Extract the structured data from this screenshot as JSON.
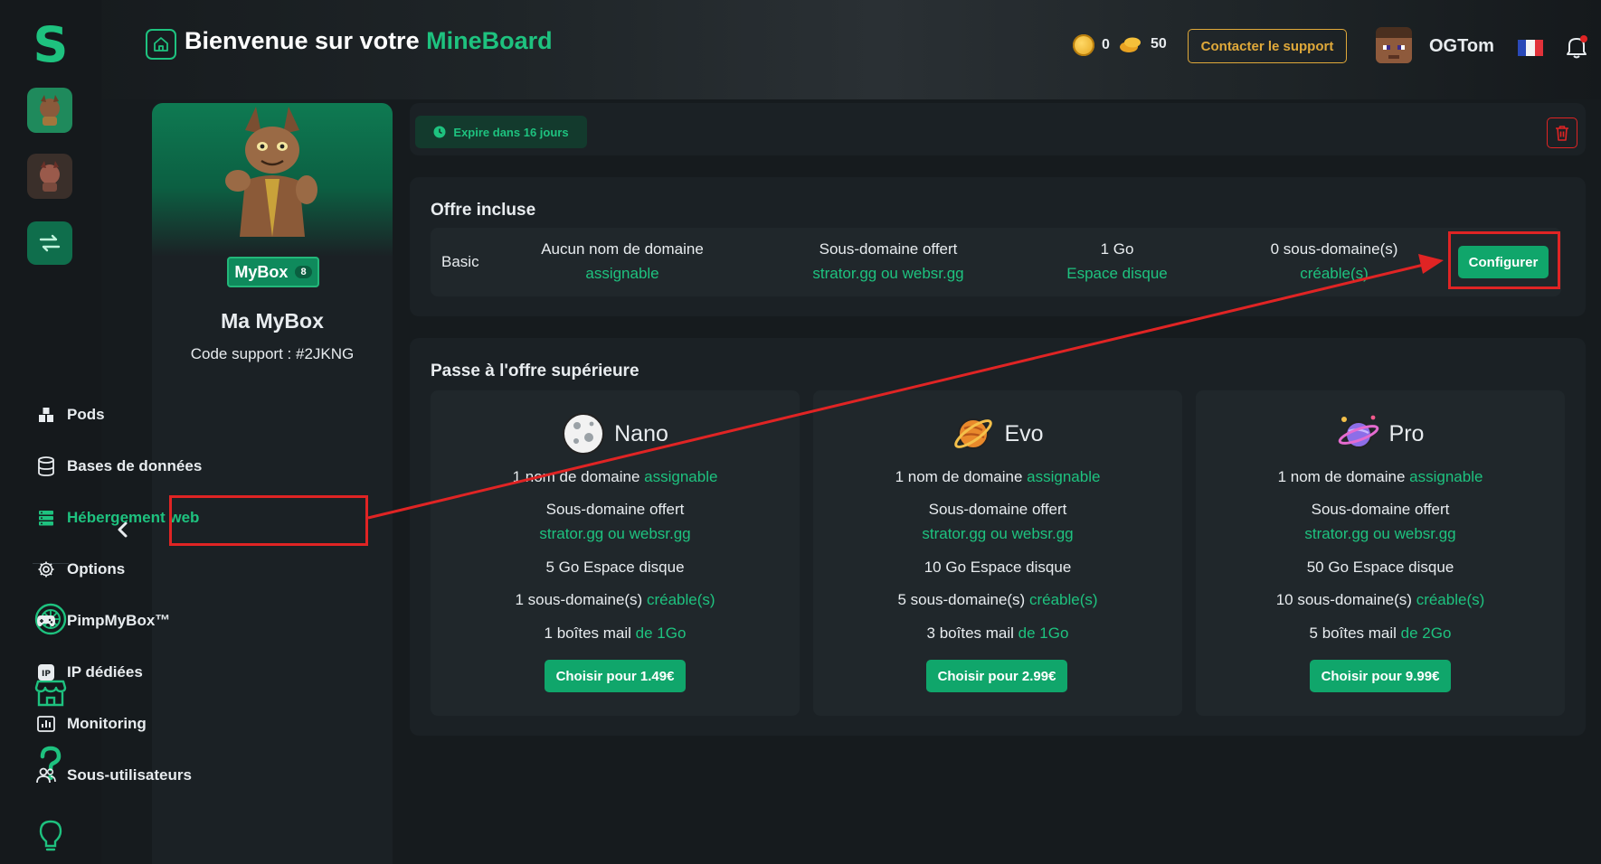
{
  "header": {
    "welcome_prefix": "Bienvenue sur votre",
    "welcome_brand": "MineBoard",
    "coins": "0",
    "credits": "50",
    "support_label": "Contacter le support",
    "username": "OGTom"
  },
  "profile": {
    "badge_label": "MyBox",
    "badge_count": "8",
    "name": "Ma MyBox",
    "support_code": "Code support : #2JKNG"
  },
  "menu": {
    "items": [
      {
        "label": "Pods"
      },
      {
        "label": "Bases de données"
      },
      {
        "label": "Hébergement web"
      },
      {
        "label": "Options"
      },
      {
        "label": "PimpMyBox™"
      },
      {
        "label": "IP dédiées"
      },
      {
        "label": "Monitoring"
      },
      {
        "label": "Sous-utilisateurs"
      }
    ]
  },
  "status": {
    "expire_label": "Expire dans 16 jours"
  },
  "included_offer": {
    "title": "Offre incluse",
    "plan": "Basic",
    "domain_line1": "Aucun nom de domaine",
    "domain_line2": "assignable",
    "subdomain_line1": "Sous-domaine offert",
    "subdomain_line2": "strator.gg ou websr.gg",
    "disk_line1": "1 Go",
    "disk_line2": "Espace disque",
    "subcount_line1": "0 sous-domaine(s)",
    "subcount_line2": "créable(s)",
    "configure_label": "Configurer"
  },
  "upgrade": {
    "title": "Passe à l'offre supérieure",
    "plans": [
      {
        "name": "Nano",
        "domain_prefix": "1 nom de domaine",
        "domain_suffix": "assignable",
        "subdomain_title": "Sous-domaine offert",
        "subdomain_hosts": "strator.gg ou websr.gg",
        "disk": "5 Go Espace disque",
        "subcount_prefix": "1 sous-domaine(s)",
        "subcount_suffix": "créable(s)",
        "mail_prefix": "1 boîtes mail",
        "mail_suffix": "de 1Go",
        "button": "Choisir pour 1.49€"
      },
      {
        "name": "Evo",
        "domain_prefix": "1 nom de domaine",
        "domain_suffix": "assignable",
        "subdomain_title": "Sous-domaine offert",
        "subdomain_hosts": "strator.gg ou websr.gg",
        "disk": "10 Go Espace disque",
        "subcount_prefix": "5 sous-domaine(s)",
        "subcount_suffix": "créable(s)",
        "mail_prefix": "3 boîtes mail",
        "mail_suffix": "de 1Go",
        "button": "Choisir pour 2.99€"
      },
      {
        "name": "Pro",
        "domain_prefix": "1 nom de domaine",
        "domain_suffix": "assignable",
        "subdomain_title": "Sous-domaine offert",
        "subdomain_hosts": "strator.gg ou websr.gg",
        "disk": "50 Go Espace disque",
        "subcount_prefix": "10 sous-domaine(s)",
        "subcount_suffix": "créable(s)",
        "mail_prefix": "5 boîtes mail",
        "mail_suffix": "de 2Go",
        "button": "Choisir pour 9.99€"
      }
    ]
  },
  "colors": {
    "accent": "#1ec27f",
    "button": "#10a66b",
    "warning": "#e0a93a",
    "danger": "#e02424",
    "background": "#161b1e",
    "card": "#1b2125"
  }
}
